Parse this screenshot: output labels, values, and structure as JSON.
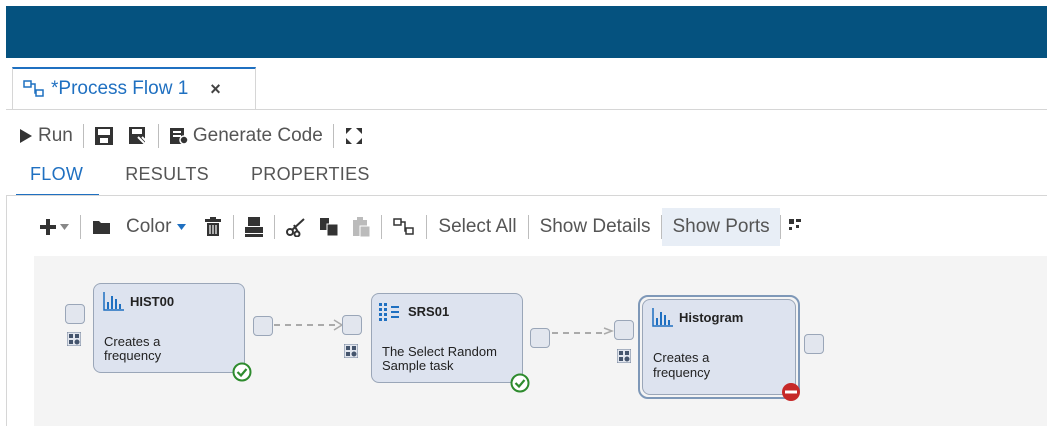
{
  "tab": {
    "label": "*Process Flow 1",
    "close": "×"
  },
  "toolbar": {
    "run": "Run",
    "generate_code": "Generate Code"
  },
  "subtabs": [
    "FLOW",
    "RESULTS",
    "PROPERTIES"
  ],
  "flow_toolbar": {
    "color": "Color",
    "select_all": "Select All",
    "show_details": "Show Details",
    "show_ports": "Show Ports"
  },
  "nodes": [
    {
      "title": "HIST00",
      "desc1": "Creates a",
      "desc2": "frequency",
      "status": "success"
    },
    {
      "title": "SRS01",
      "desc1": "The Select Random",
      "desc2": "Sample task",
      "status": "success"
    },
    {
      "title": "Histogram",
      "desc1": "Creates a",
      "desc2": "frequency",
      "status": "error"
    }
  ],
  "colors": {
    "header": "#05527f",
    "accent": "#1f70c1",
    "success": "#2e8b2e",
    "error": "#c62828"
  }
}
